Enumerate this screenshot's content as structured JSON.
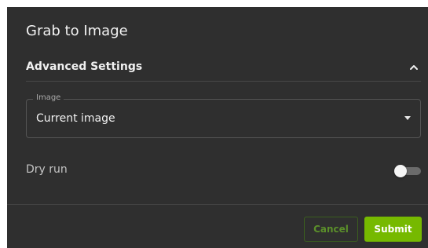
{
  "dialog": {
    "title": "Grab to Image"
  },
  "advanced": {
    "label": "Advanced Settings",
    "expanded": true,
    "chevron_icon": "chevron-up-icon"
  },
  "image_field": {
    "legend": "Image",
    "value": "Current image",
    "dropdown_icon": "caret-down-icon"
  },
  "dry_run": {
    "label": "Dry run",
    "enabled": false
  },
  "footer": {
    "cancel_label": "Cancel",
    "submit_label": "Submit"
  },
  "colors": {
    "dialog_background": "#2f2f2f",
    "accent": "#76b900",
    "cancel_text": "#5b8f2a"
  }
}
